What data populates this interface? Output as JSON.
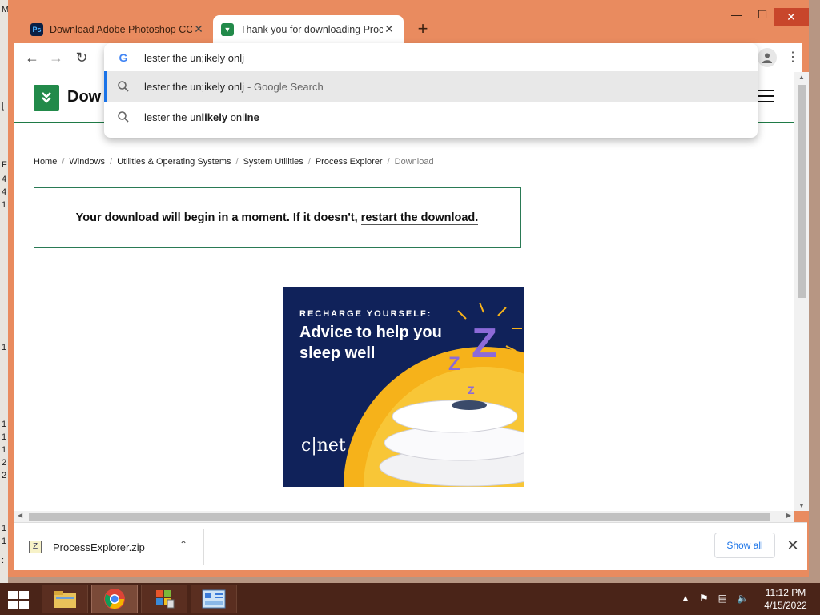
{
  "desktop": {
    "edge_chars": [
      "M",
      "[",
      "F",
      "4",
      "4",
      "1",
      "1",
      "1",
      "1",
      "1",
      "2",
      "2",
      "1",
      "1",
      ":"
    ]
  },
  "tabs": [
    {
      "title": "Download Adobe Photoshop CC",
      "favicon": "photoshop-icon",
      "fav_text": "Ps",
      "close": "✕",
      "active": false
    },
    {
      "title": "Thank you for downloading Proc",
      "favicon": "download-site-icon",
      "fav_text": "▼",
      "close": "✕",
      "active": true
    }
  ],
  "window_controls": {
    "minimize": "—",
    "maximize": "☐",
    "close": "✕",
    "new_tab": "+"
  },
  "toolbar": {
    "back": "←",
    "forward": "→",
    "reload": "↻",
    "menu": "⋮"
  },
  "omnibox": {
    "value": "lester the un;ikely onlj",
    "suggestions": [
      {
        "text": "lester the un;ikely onlj",
        "suffix": "- Google Search"
      },
      {
        "parts": [
          "lester the un",
          "likely",
          " onl",
          "ine"
        ]
      }
    ]
  },
  "site": {
    "name": "Dow",
    "menu_icon": "hamburger-icon"
  },
  "breadcrumbs": [
    "Home",
    "Windows",
    "Utilities & Operating Systems",
    "System Utilities",
    "Process Explorer",
    "Download"
  ],
  "breadcrumb_sep": "/",
  "notice": {
    "text": "Your download will begin in a moment. If it doesn't,",
    "link": "restart the download."
  },
  "ad": {
    "kicker": "RECHARGE YOURSELF:",
    "headline": "Advice to help you sleep well",
    "brand": "c|net"
  },
  "download_shelf": {
    "file": "ProcessExplorer.zip",
    "show_all": "Show all",
    "close": "✕",
    "chevron": "⌃"
  },
  "taskbar": {
    "time": "11:12 PM",
    "date": "4/15/2022"
  },
  "colors": {
    "accent_green": "#228a4a",
    "window_frame": "#e98b5f",
    "taskbar": "#4a2418",
    "link_blue": "#1a73e8",
    "ad_navy": "#10225a",
    "ad_yellow": "#f6b21a"
  }
}
